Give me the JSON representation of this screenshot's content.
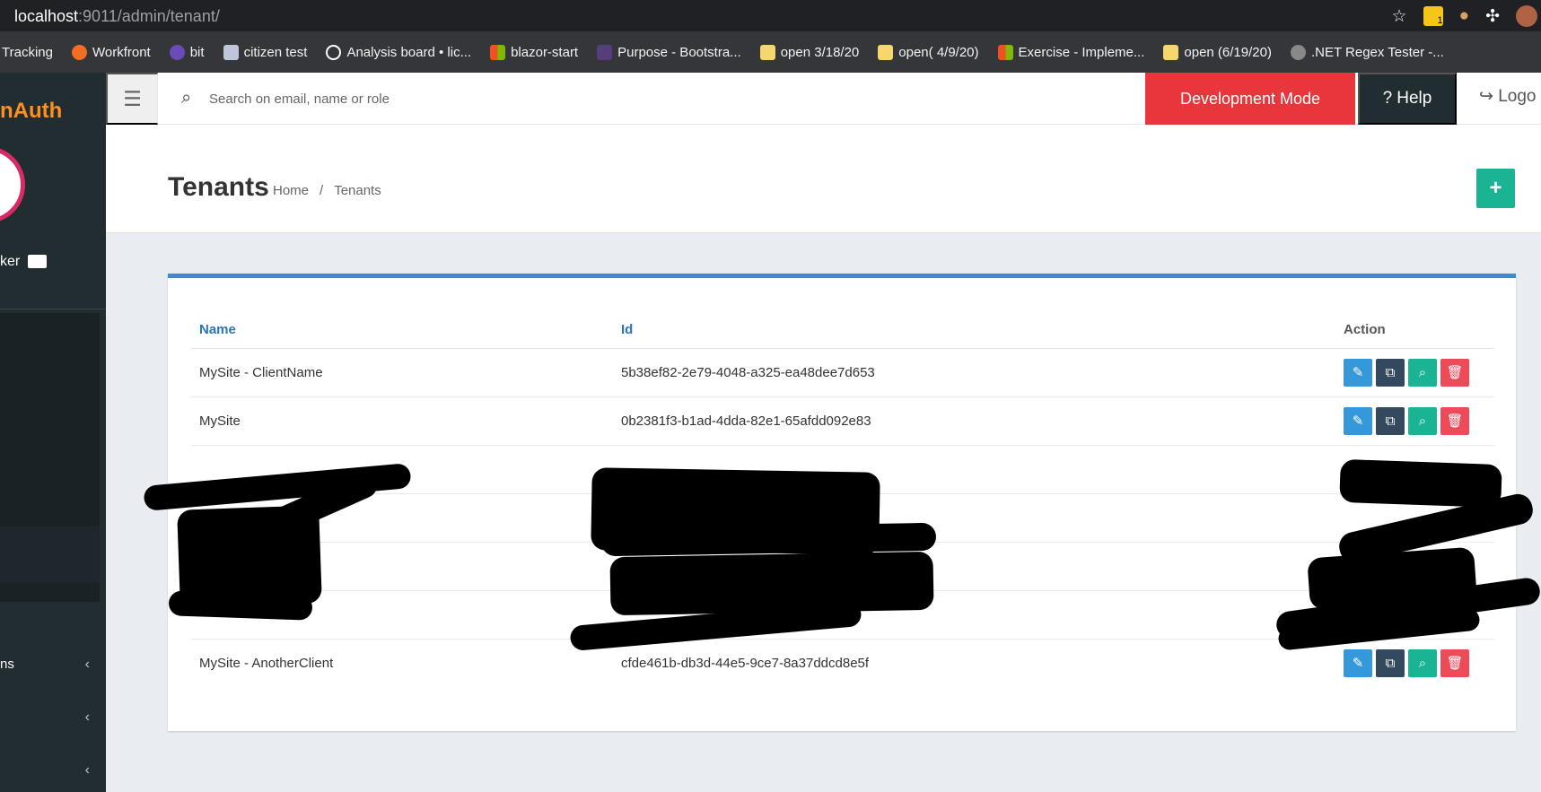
{
  "browser": {
    "url_host": "localhost",
    "url_rest": ":9011/admin/tenant/",
    "star_icon": "☆",
    "ext_badge": "1",
    "bookmarks": [
      {
        "label": "Tracking"
      },
      {
        "label": "Workfront"
      },
      {
        "label": "bit"
      },
      {
        "label": "citizen test"
      },
      {
        "label": "Analysis board • lic..."
      },
      {
        "label": "blazor-start"
      },
      {
        "label": "Purpose - Bootstra..."
      },
      {
        "label": "open 3/18/20"
      },
      {
        "label": "open( 4/9/20)"
      },
      {
        "label": "Exercise - Impleme..."
      },
      {
        "label": "open (6/19/20)"
      },
      {
        "label": ".NET Regex Tester -..."
      }
    ]
  },
  "sidebar": {
    "app_name_left": "n",
    "app_name_right": "Auth",
    "user_name": "ker",
    "items": [
      {
        "label": "ns"
      },
      {
        "label": ""
      },
      {
        "label": ""
      }
    ]
  },
  "topbar": {
    "search_placeholder": "Search on email, name or role",
    "development_mode": "Development Mode",
    "help": "Help",
    "logout": "Logo"
  },
  "header": {
    "title": "Tenants",
    "breadcrumb": [
      "Home",
      "Tenants"
    ],
    "add_button": "+"
  },
  "table": {
    "columns": [
      "Name",
      "Id",
      "Action"
    ],
    "rows": [
      {
        "name": "MySite - ClientName",
        "id": "5b38ef82-2e79-4048-a325-ea48dee7d653"
      },
      {
        "name": "MySite",
        "id": "0b2381f3-b1ad-4dda-82e1-65afdd092e83"
      },
      {
        "name": "",
        "id": ""
      },
      {
        "name": "",
        "id": ""
      },
      {
        "name": "",
        "id": ""
      },
      {
        "name": "",
        "id": ""
      },
      {
        "name": "MySite - AnotherClient",
        "id": "cfde461b-db3d-44e5-9ce7-8a37ddcd8e5f"
      }
    ]
  },
  "icons": {
    "edit": "edit-icon",
    "copy": "copy-icon",
    "view": "search-icon",
    "delete": "trash-icon"
  },
  "colors": {
    "primary": "#3e8bd3",
    "success": "#1ab394",
    "danger": "#ed4b59",
    "dark": "#34495e",
    "development": "#e8363c"
  }
}
